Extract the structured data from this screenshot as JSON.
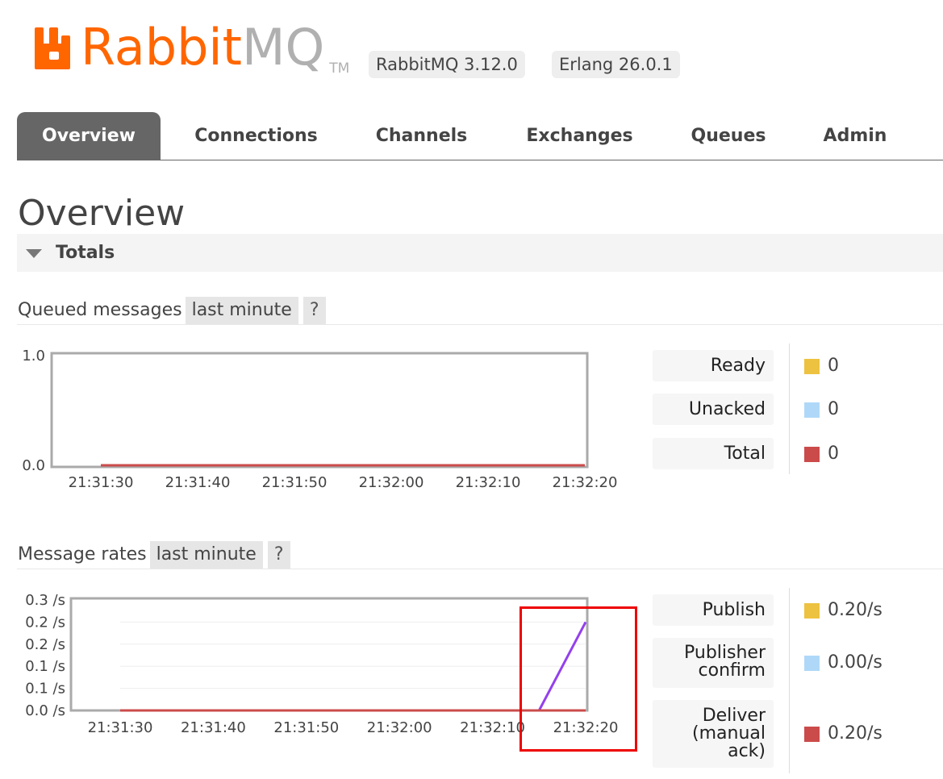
{
  "header": {
    "logo_primary": "Rabbit",
    "logo_secondary": "MQ",
    "logo_tm": "TM",
    "rabbitmq_version": "RabbitMQ 3.12.0",
    "erlang_version": "Erlang 26.0.1"
  },
  "tabs": [
    {
      "label": "Overview",
      "active": true
    },
    {
      "label": "Connections",
      "active": false
    },
    {
      "label": "Channels",
      "active": false
    },
    {
      "label": "Exchanges",
      "active": false
    },
    {
      "label": "Queues",
      "active": false
    },
    {
      "label": "Admin",
      "active": false
    }
  ],
  "page_title": "Overview",
  "totals_section": {
    "label": "Totals",
    "expanded": true
  },
  "queued_messages": {
    "title": "Queued messages",
    "range": "last minute",
    "help": "?",
    "legend": [
      {
        "label": "Ready",
        "value": "0",
        "color": "#edc240"
      },
      {
        "label": "Unacked",
        "value": "0",
        "color": "#afd8f8"
      },
      {
        "label": "Total",
        "value": "0",
        "color": "#cb4b4b"
      }
    ]
  },
  "message_rates": {
    "title": "Message rates",
    "range": "last minute",
    "help": "?",
    "legend": [
      {
        "label": "Publish",
        "value": "0.20/s",
        "color": "#edc240"
      },
      {
        "label": "Publisher confirm",
        "label_lines": [
          "Publisher",
          "confirm"
        ],
        "value": "0.00/s",
        "color": "#afd8f8"
      },
      {
        "label": "Deliver (manual ack)",
        "label_lines": [
          "Deliver",
          "(manual",
          "ack)"
        ],
        "value": "0.20/s",
        "color": "#cb4b4b"
      }
    ]
  },
  "chart_data": [
    {
      "type": "line",
      "title": "Queued messages",
      "x": [
        "21:31:30",
        "21:31:40",
        "21:31:50",
        "21:32:00",
        "21:32:10",
        "21:32:20"
      ],
      "y_ticks": [
        "1.0",
        "0.0"
      ],
      "ylim": [
        0,
        1
      ],
      "series": [
        {
          "name": "Ready",
          "color": "#edc240",
          "values": [
            0,
            0,
            0,
            0,
            0,
            0
          ]
        },
        {
          "name": "Unacked",
          "color": "#afd8f8",
          "values": [
            0,
            0,
            0,
            0,
            0,
            0
          ]
        },
        {
          "name": "Total",
          "color": "#cb4b4b",
          "values": [
            0,
            0,
            0,
            0,
            0,
            0
          ]
        }
      ]
    },
    {
      "type": "line",
      "title": "Message rates",
      "x": [
        "21:31:30",
        "21:31:40",
        "21:31:50",
        "21:32:00",
        "21:32:10",
        "21:32:20"
      ],
      "y_ticks": [
        "0.3 /s",
        "0.2 /s",
        "0.2 /s",
        "0.1 /s",
        "0.1 /s",
        "0.0 /s"
      ],
      "ylim": [
        0,
        0.25
      ],
      "series": [
        {
          "name": "Publish",
          "color": "#9440ed",
          "points": [
            [
              "21:31:30",
              0
            ],
            [
              "21:32:15",
              0
            ],
            [
              "21:32:20",
              0.2
            ]
          ]
        },
        {
          "name": "Deliver (manual ack)",
          "color": "#cb4b4b",
          "points": [
            [
              "21:31:30",
              0
            ],
            [
              "21:32:20",
              0
            ]
          ]
        }
      ]
    }
  ]
}
